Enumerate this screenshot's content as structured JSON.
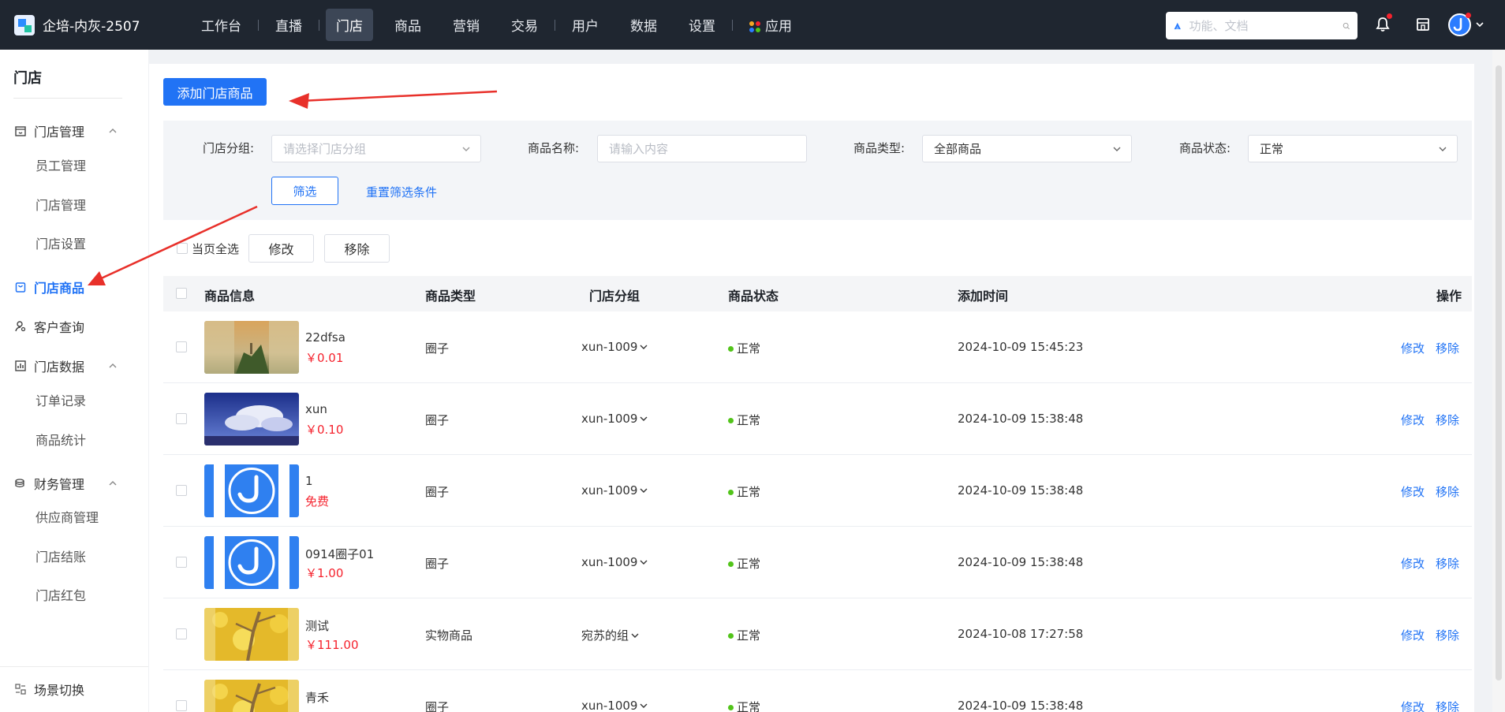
{
  "app": {
    "title": "企培-内灰-2507"
  },
  "nav": {
    "items": [
      {
        "label": "工作台"
      },
      {
        "label": "直播"
      },
      {
        "label": "门店"
      },
      {
        "label": "商品"
      },
      {
        "label": "营销"
      },
      {
        "label": "交易"
      },
      {
        "label": "用户"
      },
      {
        "label": "数据"
      },
      {
        "label": "设置"
      },
      {
        "label": "应用"
      }
    ],
    "active": "门店"
  },
  "search": {
    "placeholder": "功能、文档"
  },
  "sidebar": {
    "title": "门店",
    "groups": [
      {
        "label": "门店管理",
        "icon": "store-icon",
        "children": [
          "员工管理",
          "门店管理",
          "门店设置"
        ]
      },
      {
        "label": "门店商品",
        "icon": "bag-icon",
        "active": true
      },
      {
        "label": "客户查询",
        "icon": "user-search-icon"
      },
      {
        "label": "门店数据",
        "icon": "chart-icon",
        "children": [
          "订单记录",
          "商品统计"
        ]
      },
      {
        "label": "财务管理",
        "icon": "coins-icon",
        "children": [
          "供应商管理",
          "门店结账",
          "门店红包"
        ]
      }
    ],
    "footer": "场景切换"
  },
  "toolbar": {
    "add_label": "添加门店商品"
  },
  "filters": {
    "group_label": "门店分组:",
    "group_placeholder": "请选择门店分组",
    "name_label": "商品名称:",
    "name_placeholder": "请输入内容",
    "type_label": "商品类型:",
    "type_value": "全部商品",
    "status_label": "商品状态:",
    "status_value": "正常",
    "filter_label": "筛选",
    "reset_label": "重置筛选条件"
  },
  "bulk": {
    "select_all": "当页全选",
    "edit": "修改",
    "remove": "移除"
  },
  "table": {
    "headers": {
      "info": "商品信息",
      "type": "商品类型",
      "group": "门店分组",
      "status": "商品状态",
      "time": "添加时间",
      "ops": "操作"
    },
    "rows": [
      {
        "name": "22dfsa",
        "price": "￥0.01",
        "type": "圈子",
        "group": "xun-1009",
        "status": "正常",
        "time": "2024-10-09 15:45:23",
        "edit": "修改",
        "remove": "移除",
        "thumb": "landscape-sunset"
      },
      {
        "name": "xun",
        "price": "￥0.10",
        "type": "圈子",
        "group": "xun-1009",
        "status": "正常",
        "time": "2024-10-09 15:38:48",
        "edit": "修改",
        "remove": "移除",
        "thumb": "clouds-sky"
      },
      {
        "name": "1",
        "price": "免费",
        "type": "圈子",
        "group": "xun-1009",
        "status": "正常",
        "time": "2024-10-09 15:38:48",
        "edit": "修改",
        "remove": "移除",
        "thumb": "duck-logo"
      },
      {
        "name": "0914圈子01",
        "price": "￥1.00",
        "type": "圈子",
        "group": "xun-1009",
        "status": "正常",
        "time": "2024-10-09 15:38:48",
        "edit": "修改",
        "remove": "移除",
        "thumb": "duck-logo"
      },
      {
        "name": "测试",
        "price": "￥111.00",
        "type": "实物商品",
        "group": "宛苏的组",
        "status": "正常",
        "time": "2024-10-08 17:27:58",
        "edit": "修改",
        "remove": "移除",
        "thumb": "yellow-leaves"
      },
      {
        "name": "青禾",
        "price": "",
        "type": "圈子",
        "group": "xun-1009",
        "status": "正常",
        "time": "2024-10-09 15:38:48",
        "edit": "修改",
        "remove": "移除",
        "thumb": "yellow-leaves"
      }
    ]
  },
  "colors": {
    "topbar": "#1f2630",
    "accent": "#2173f5",
    "price": "#f5222d",
    "status_ok": "#52c41a",
    "arrow": "#e8302a"
  }
}
